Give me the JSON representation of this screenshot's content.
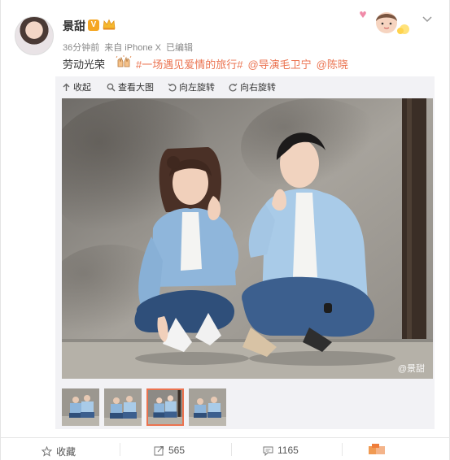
{
  "user": {
    "name": "景甜",
    "verified_badge": "V",
    "time": "36分钟前",
    "source": "来自 iPhone X",
    "edited": "已编辑"
  },
  "post": {
    "text": "劳动光荣",
    "hashtag": "#一场遇见爱情的旅行#",
    "mentions": [
      "@导演毛卫宁",
      "@陈晓"
    ]
  },
  "toolbar": {
    "collapse": "收起",
    "view_large": "查看大图",
    "rotate_left": "向左旋转",
    "rotate_right": "向右旋转"
  },
  "photo": {
    "watermark": "@景甜"
  },
  "thumbnails": {
    "count": 4,
    "active_index": 2
  },
  "actions": {
    "favorite": "收藏",
    "repost_count": "565",
    "comment_count": "1165"
  },
  "colors": {
    "accent": "#eb7350",
    "verified": "#f5a623",
    "panel": "#f2f2f5"
  }
}
